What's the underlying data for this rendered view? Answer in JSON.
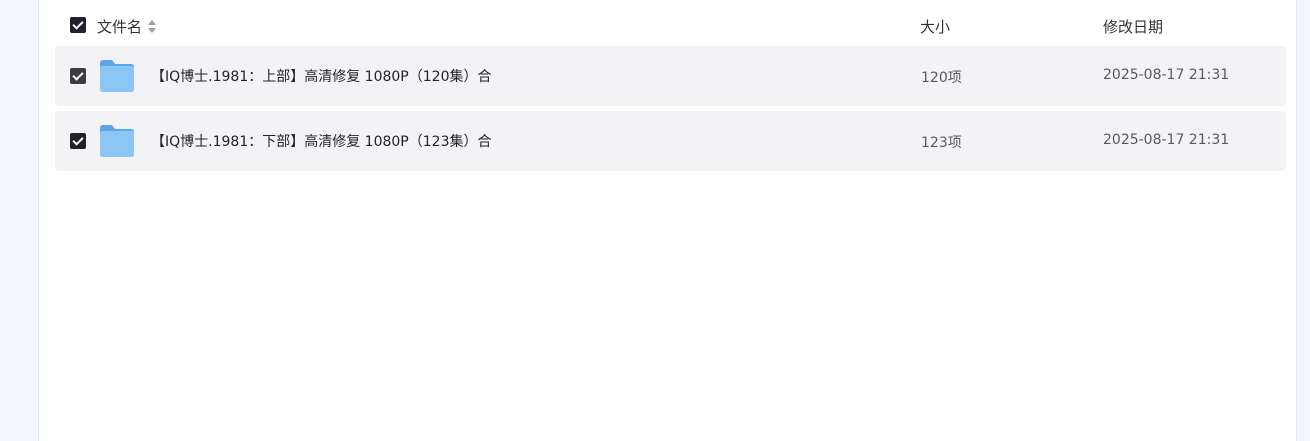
{
  "table": {
    "header": {
      "name_label": "文件名",
      "size_label": "大小",
      "date_label": "修改日期"
    },
    "rows": [
      {
        "name": "【IQ博士.1981：上部】高清修复 1080P（120集）合",
        "size": "120项",
        "modified": "2025-08-17 21:31"
      },
      {
        "name": "【IQ博士.1981：下部】高清修复 1080P（123集）合",
        "size": "123项",
        "modified": "2025-08-17 21:31"
      }
    ]
  },
  "colors": {
    "folder": "#7fbcf2",
    "row_background": "#f3f3f5",
    "checkbox": "#1f2329"
  }
}
